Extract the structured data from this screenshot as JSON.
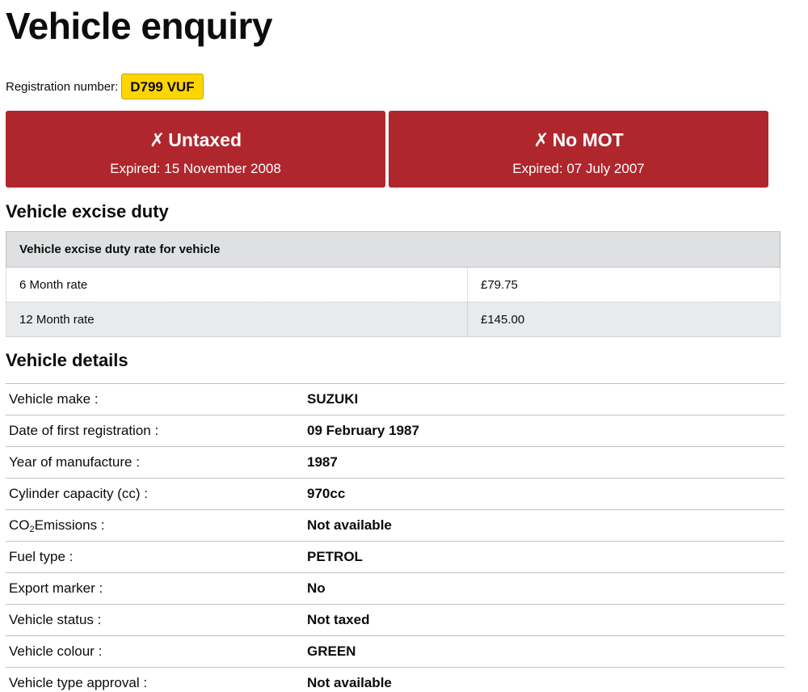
{
  "page": {
    "title": "Vehicle enquiry"
  },
  "registration": {
    "label": "Registration number:",
    "plate": "D799 VUF"
  },
  "status_cards": [
    {
      "icon": "cross-icon",
      "icon_glyph": "✗",
      "heading": "Untaxed",
      "subtext": "Expired: 15 November 2008",
      "color": "#b0262d"
    },
    {
      "icon": "cross-icon",
      "icon_glyph": "✗",
      "heading": "No MOT",
      "subtext": "Expired: 07 July 2007",
      "color": "#b0262d"
    }
  ],
  "excise_duty": {
    "heading": "Vehicle excise duty",
    "table_header": "Vehicle excise duty rate for vehicle",
    "rows": [
      {
        "name": "6 Month rate",
        "value": "£79.75"
      },
      {
        "name": "12 Month rate",
        "value": "£145.00"
      }
    ]
  },
  "vehicle_details": {
    "heading": "Vehicle details",
    "rows": [
      {
        "label": "Vehicle make :",
        "value": "SUZUKI"
      },
      {
        "label": "Date of first registration :",
        "value": "09 February 1987"
      },
      {
        "label": "Year of manufacture :",
        "value": "1987"
      },
      {
        "label": "Cylinder capacity (cc) :",
        "value": "970cc"
      },
      {
        "label_prefix": "CO",
        "label_sub": "2",
        "label_suffix": "Emissions :",
        "value": "Not available"
      },
      {
        "label": "Fuel type :",
        "value": "PETROL"
      },
      {
        "label": "Export marker :",
        "value": "No"
      },
      {
        "label": "Vehicle status :",
        "value": "Not taxed"
      },
      {
        "label": "Vehicle colour :",
        "value": "GREEN"
      },
      {
        "label": "Vehicle type approval :",
        "value": "Not available"
      }
    ]
  },
  "colors": {
    "plate_yellow": "#ffd500",
    "alert_red": "#b0262d",
    "table_header_grey": "#dee0e2"
  }
}
